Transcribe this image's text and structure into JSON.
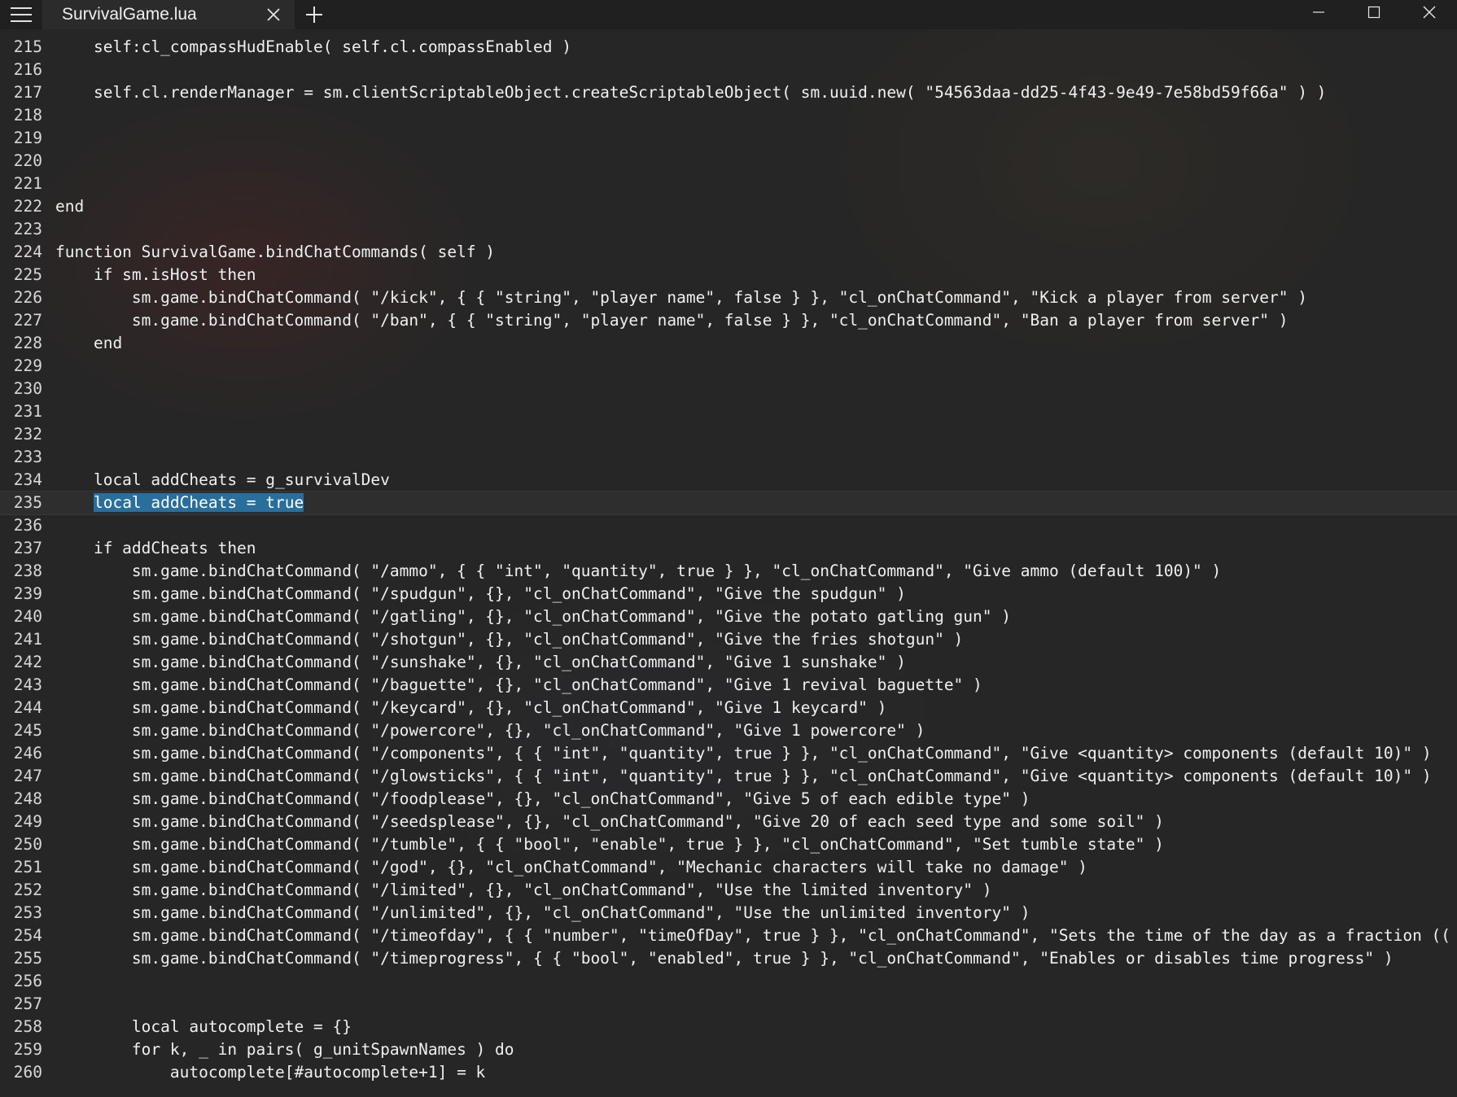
{
  "window": {
    "tab_title": "SurvivalGame.lua",
    "icons": {
      "menu": "hamburger-menu-icon",
      "close_tab": "close-icon",
      "new_tab": "plus-icon",
      "minimize": "minimize-icon",
      "maximize": "maximize-icon",
      "close_window": "close-icon"
    }
  },
  "editor": {
    "current_line": 235,
    "lines": [
      {
        "n": "215",
        "code": "    self:cl_compassHudEnable( self.cl.compassEnabled )"
      },
      {
        "n": "216",
        "code": ""
      },
      {
        "n": "217",
        "code": "    self.cl.renderManager = sm.clientScriptableObject.createScriptableObject( sm.uuid.new( \"54563daa-dd25-4f43-9e49-7e58bd59f66a\" ) )"
      },
      {
        "n": "218",
        "code": ""
      },
      {
        "n": "219",
        "code": ""
      },
      {
        "n": "220",
        "code": ""
      },
      {
        "n": "221",
        "code": ""
      },
      {
        "n": "222",
        "code": "end"
      },
      {
        "n": "223",
        "code": ""
      },
      {
        "n": "224",
        "code": "function SurvivalGame.bindChatCommands( self )"
      },
      {
        "n": "225",
        "code": "    if sm.isHost then"
      },
      {
        "n": "226",
        "code": "        sm.game.bindChatCommand( \"/kick\", { { \"string\", \"player name\", false } }, \"cl_onChatCommand\", \"Kick a player from server\" )"
      },
      {
        "n": "227",
        "code": "        sm.game.bindChatCommand( \"/ban\", { { \"string\", \"player name\", false } }, \"cl_onChatCommand\", \"Ban a player from server\" )"
      },
      {
        "n": "228",
        "code": "    end"
      },
      {
        "n": "229",
        "code": ""
      },
      {
        "n": "230",
        "code": ""
      },
      {
        "n": "231",
        "code": ""
      },
      {
        "n": "232",
        "code": ""
      },
      {
        "n": "233",
        "code": ""
      },
      {
        "n": "234",
        "code": "    local addCheats = g_survivalDev"
      },
      {
        "n": "235",
        "code": "    ",
        "selected": "local addCheats = true"
      },
      {
        "n": "236",
        "code": ""
      },
      {
        "n": "237",
        "code": "    if addCheats then"
      },
      {
        "n": "238",
        "code": "        sm.game.bindChatCommand( \"/ammo\", { { \"int\", \"quantity\", true } }, \"cl_onChatCommand\", \"Give ammo (default 100)\" )"
      },
      {
        "n": "239",
        "code": "        sm.game.bindChatCommand( \"/spudgun\", {}, \"cl_onChatCommand\", \"Give the spudgun\" )"
      },
      {
        "n": "240",
        "code": "        sm.game.bindChatCommand( \"/gatling\", {}, \"cl_onChatCommand\", \"Give the potato gatling gun\" )"
      },
      {
        "n": "241",
        "code": "        sm.game.bindChatCommand( \"/shotgun\", {}, \"cl_onChatCommand\", \"Give the fries shotgun\" )"
      },
      {
        "n": "242",
        "code": "        sm.game.bindChatCommand( \"/sunshake\", {}, \"cl_onChatCommand\", \"Give 1 sunshake\" )"
      },
      {
        "n": "243",
        "code": "        sm.game.bindChatCommand( \"/baguette\", {}, \"cl_onChatCommand\", \"Give 1 revival baguette\" )"
      },
      {
        "n": "244",
        "code": "        sm.game.bindChatCommand( \"/keycard\", {}, \"cl_onChatCommand\", \"Give 1 keycard\" )"
      },
      {
        "n": "245",
        "code": "        sm.game.bindChatCommand( \"/powercore\", {}, \"cl_onChatCommand\", \"Give 1 powercore\" )"
      },
      {
        "n": "246",
        "code": "        sm.game.bindChatCommand( \"/components\", { { \"int\", \"quantity\", true } }, \"cl_onChatCommand\", \"Give <quantity> components (default 10)\" )"
      },
      {
        "n": "247",
        "code": "        sm.game.bindChatCommand( \"/glowsticks\", { { \"int\", \"quantity\", true } }, \"cl_onChatCommand\", \"Give <quantity> components (default 10)\" )"
      },
      {
        "n": "248",
        "code": "        sm.game.bindChatCommand( \"/foodplease\", {}, \"cl_onChatCommand\", \"Give 5 of each edible type\" )"
      },
      {
        "n": "249",
        "code": "        sm.game.bindChatCommand( \"/seedsplease\", {}, \"cl_onChatCommand\", \"Give 20 of each seed type and some soil\" )"
      },
      {
        "n": "250",
        "code": "        sm.game.bindChatCommand( \"/tumble\", { { \"bool\", \"enable\", true } }, \"cl_onChatCommand\", \"Set tumble state\" )"
      },
      {
        "n": "251",
        "code": "        sm.game.bindChatCommand( \"/god\", {}, \"cl_onChatCommand\", \"Mechanic characters will take no damage\" )"
      },
      {
        "n": "252",
        "code": "        sm.game.bindChatCommand( \"/limited\", {}, \"cl_onChatCommand\", \"Use the limited inventory\" )"
      },
      {
        "n": "253",
        "code": "        sm.game.bindChatCommand( \"/unlimited\", {}, \"cl_onChatCommand\", \"Use the unlimited inventory\" )"
      },
      {
        "n": "254",
        "code": "        sm.game.bindChatCommand( \"/timeofday\", { { \"number\", \"timeOfDay\", true } }, \"cl_onChatCommand\", \"Sets the time of the day as a fraction (("
      },
      {
        "n": "255",
        "code": "        sm.game.bindChatCommand( \"/timeprogress\", { { \"bool\", \"enabled\", true } }, \"cl_onChatCommand\", \"Enables or disables time progress\" )"
      },
      {
        "n": "256",
        "code": ""
      },
      {
        "n": "257",
        "code": ""
      },
      {
        "n": "258",
        "code": "        local autocomplete = {}"
      },
      {
        "n": "259",
        "code": "        for k, _ in pairs( g_unitSpawnNames ) do"
      },
      {
        "n": "260",
        "code": "            autocomplete[#autocomplete+1] = k"
      }
    ]
  },
  "colors": {
    "background": "#262626",
    "titlebar": "#202020",
    "selection": "#2a6f9c"
  }
}
